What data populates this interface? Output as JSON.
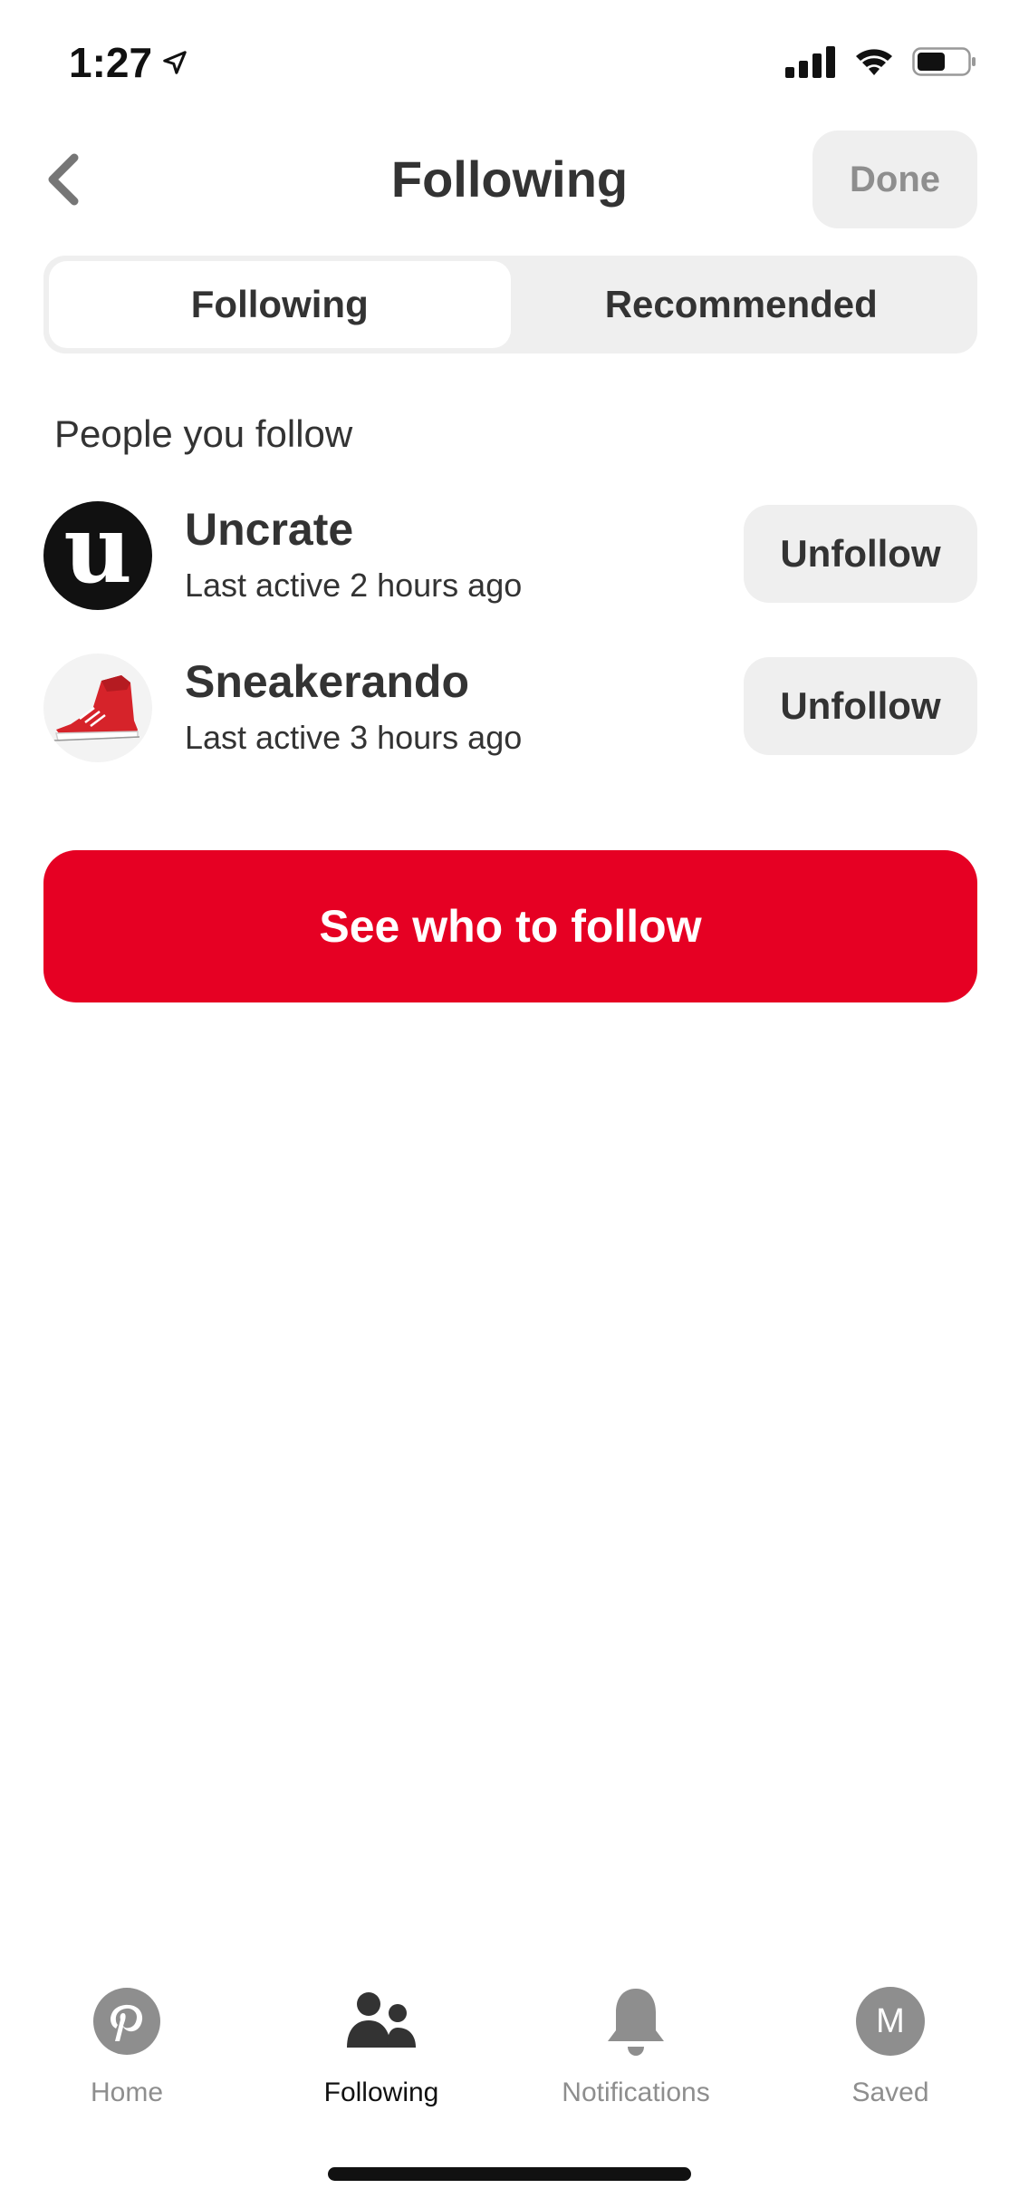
{
  "status_bar": {
    "time": "1:27"
  },
  "header": {
    "title": "Following",
    "done_label": "Done"
  },
  "tabs": [
    {
      "label": "Following",
      "active": true
    },
    {
      "label": "Recommended",
      "active": false
    }
  ],
  "section_label": "People you follow",
  "following": [
    {
      "name": "Uncrate",
      "last_active": "Last active 2 hours ago",
      "action_label": "Unfollow",
      "avatar_letter": "u"
    },
    {
      "name": "Sneakerando",
      "last_active": "Last active 3 hours ago",
      "action_label": "Unfollow"
    }
  ],
  "cta_label": "See who to follow",
  "bottom_nav": {
    "items": [
      {
        "label": "Home",
        "icon": "pinterest-icon",
        "active": false
      },
      {
        "label": "Following",
        "icon": "people-icon",
        "active": true
      },
      {
        "label": "Notifications",
        "icon": "bell-icon",
        "active": false
      },
      {
        "label": "Saved",
        "icon": "profile-avatar",
        "active": false,
        "avatar_letter": "M"
      }
    ]
  },
  "colors": {
    "accent": "#e60023",
    "surface": "#efefef",
    "text": "#333333",
    "muted": "#8e8e8e"
  }
}
